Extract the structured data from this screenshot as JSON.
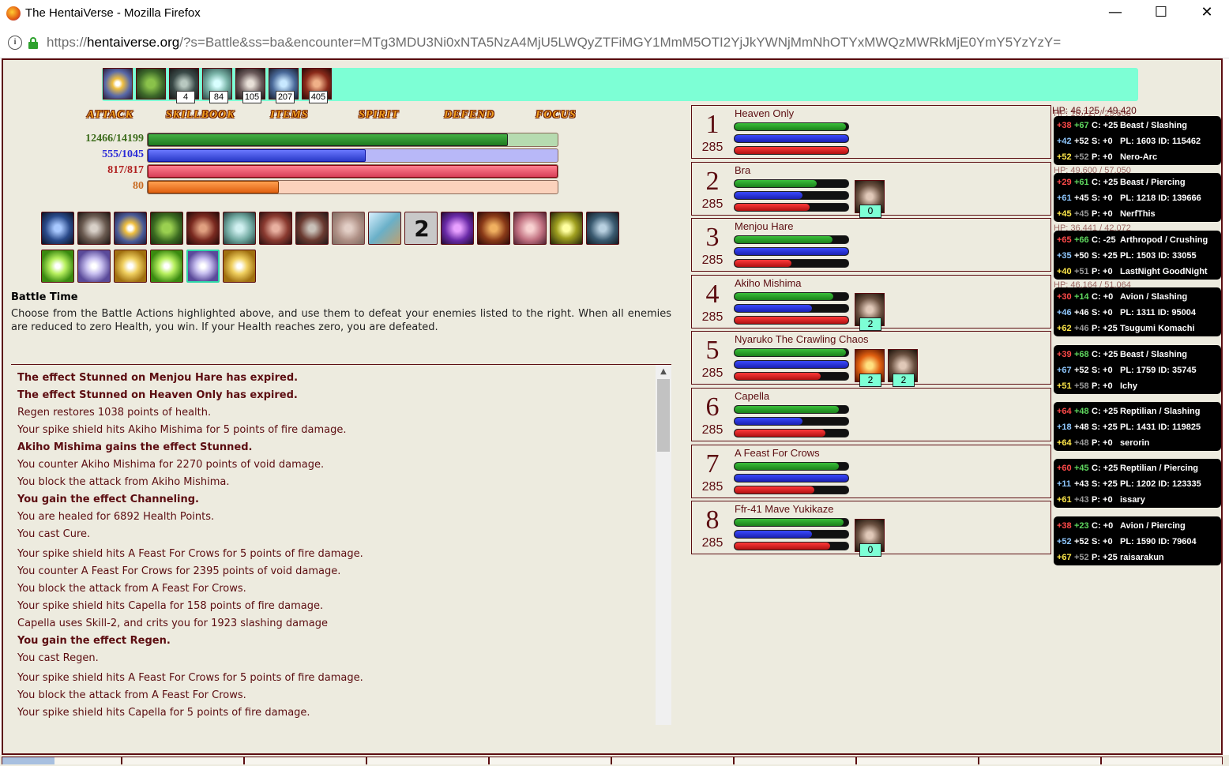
{
  "window": {
    "title": "The HentaiVerse - Mozilla Firefox",
    "minimize": "—",
    "maximize": "☐",
    "close": "✕"
  },
  "urlbar": {
    "prefix": "https://",
    "domain": "hentaiverse.org",
    "path": "/?s=Battle&ss=ba&encounter=MTg3MDU3Ni0xNTA5NzA4MjU5LWQyZTFiMGY1MmM5OTI2YjJkYWNjMmNhOTYxMWQzMWRkMjE0YmY5YzYzY="
  },
  "effects": {
    "counts": [
      "4",
      "84",
      "105",
      "207",
      "405"
    ]
  },
  "menu": {
    "attack": "ATTACK",
    "skillbook": "SKILLBOOK",
    "items": "ITEMS",
    "spirit": "SPIRIT",
    "defend": "DEFEND",
    "focus": "FOCUS"
  },
  "player": {
    "hp": {
      "text": "12466/14199",
      "fraction": 0.878
    },
    "mp": {
      "text": "555/1045",
      "fraction": 0.531
    },
    "sp": {
      "text": "817/817",
      "fraction": 1.0
    },
    "oc": {
      "text": "80",
      "fraction": 0.32
    }
  },
  "skills": {
    "count_label": "2"
  },
  "battle": {
    "title": "Battle Time",
    "description": "Choose from the Battle Actions highlighted above, and use them to defeat your enemies listed to the right. When all enemies are reduced to zero Health, you win. If your Health reaches zero, you are defeated."
  },
  "log": [
    {
      "text": "The effect Stunned on Menjou Hare has expired.",
      "bold": true
    },
    {
      "text": "The effect Stunned on Heaven Only has expired.",
      "bold": true
    },
    {
      "text": "Regen restores 1038 points of health.",
      "bold": false
    },
    {
      "text": "Your spike shield hits Akiho Mishima for 5 points of fire damage.",
      "bold": false
    },
    {
      "text": "Akiho Mishima gains the effect Stunned.",
      "bold": true
    },
    {
      "text": "You counter Akiho Mishima for 2270 points of void damage.",
      "bold": false
    },
    {
      "text": "You block the attack from Akiho Mishima.",
      "bold": false
    },
    {
      "text": "You gain the effect Channeling.",
      "bold": true
    },
    {
      "text": "You are healed for 6892 Health Points.",
      "bold": false
    },
    {
      "text": "You cast Cure.",
      "bold": false
    },
    {
      "text": "Your spike shield hits A Feast For Crows for 5 points of fire damage.",
      "bold": false
    },
    {
      "text": "You counter A Feast For Crows for 2395 points of void damage.",
      "bold": false
    },
    {
      "text": "You block the attack from A Feast For Crows.",
      "bold": false
    },
    {
      "text": "Your spike shield hits Capella for 158 points of fire damage.",
      "bold": false
    },
    {
      "text": "Capella uses Skill-2, and crits you for 1923 slashing damage",
      "bold": false
    },
    {
      "text": "You gain the effect Regen.",
      "bold": true
    },
    {
      "text": "You cast Regen.",
      "bold": false
    },
    {
      "text": "Your spike shield hits A Feast For Crows for 5 points of fire damage.",
      "bold": false
    },
    {
      "text": "You block the attack from A Feast For Crows.",
      "bold": false
    },
    {
      "text": "Your spike shield hits Capella for 5 points of fire damage.",
      "bold": false
    }
  ],
  "monsters": [
    {
      "num": "1",
      "level": "285",
      "name": "Heaven Only",
      "hp": 0.98,
      "mp": 1.0,
      "sp": 1.0,
      "effects": []
    },
    {
      "num": "2",
      "level": "285",
      "name": "Bra",
      "hp": 0.72,
      "mp": 0.6,
      "sp": 0.66,
      "effects": [
        "0"
      ]
    },
    {
      "num": "3",
      "level": "285",
      "name": "Menjou Hare",
      "hp": 0.86,
      "mp": 1.0,
      "sp": 0.5,
      "effects": []
    },
    {
      "num": "4",
      "level": "285",
      "name": "Akiho Mishima",
      "hp": 0.87,
      "mp": 0.68,
      "sp": 1.0,
      "effects": [
        "2"
      ]
    },
    {
      "num": "5",
      "level": "285",
      "name": "Nyaruko The Crawling Chaos",
      "hp": 0.98,
      "mp": 1.0,
      "sp": 0.76,
      "effects": [
        "2",
        "2"
      ]
    },
    {
      "num": "6",
      "level": "285",
      "name": "Capella",
      "hp": 0.92,
      "mp": 0.6,
      "sp": 0.8,
      "effects": []
    },
    {
      "num": "7",
      "level": "285",
      "name": "A Feast For Crows",
      "hp": 0.92,
      "mp": 1.0,
      "sp": 0.7,
      "effects": []
    },
    {
      "num": "8",
      "level": "285",
      "name": "Ffr-41 Mave Yukikaze",
      "hp": 0.96,
      "mp": 0.68,
      "sp": 0.84,
      "effects": [
        "0"
      ]
    }
  ],
  "tooltip_header": "HP: 46,125 / 49,420",
  "tooltips": [
    {
      "r1": [
        "+38",
        "+67",
        "C: +25",
        "Beast / Slashing"
      ],
      "r2": [
        "+42",
        "+52",
        "S: +0",
        "PL: 1603 ID: 115462"
      ],
      "r3": [
        "+52",
        "+52",
        "P: +0",
        "Nero-Arc"
      ],
      "hpnote": "HP: 16,717 / 23,600"
    },
    {
      "r1": [
        "+29",
        "+61",
        "C: +25",
        "Beast / Piercing"
      ],
      "r2": [
        "+61",
        "+45",
        "S: +0",
        "PL: 1218 ID: 139666"
      ],
      "r3": [
        "+45",
        "+45",
        "P: +0",
        "NerfThis"
      ],
      "hpnote": "HP: 49,600 / 57,050"
    },
    {
      "r1": [
        "+65",
        "+66",
        "C: -25",
        "Arthropod / Crushing"
      ],
      "r2": [
        "+35",
        "+50",
        "S: +25",
        "PL: 1503 ID: 33055"
      ],
      "r3": [
        "+40",
        "+51",
        "P: +0",
        "LastNight GoodNight"
      ],
      "hpnote": "HP: 36,441 / 42,072"
    },
    {
      "r1": [
        "+30",
        "+14",
        "C: +0",
        "Avion / Slashing"
      ],
      "r2": [
        "+46",
        "+46",
        "S: +0",
        "PL: 1311 ID: 95004"
      ],
      "r3": [
        "+62",
        "+46",
        "P: +25",
        "Tsugumi Komachi"
      ],
      "hpnote": "HP: 46,164 / 51,064"
    },
    {
      "r1": [
        "+39",
        "+68",
        "C: +25",
        "Beast / Slashing"
      ],
      "r2": [
        "+67",
        "+52",
        "S: +0",
        "PL: 1759 ID: 35745"
      ],
      "r3": [
        "+51",
        "+58",
        "P: +0",
        "Ichy"
      ],
      "hpnote": ""
    },
    {
      "r1": [
        "+64",
        "+48",
        "C: +25",
        "Reptilian / Slashing"
      ],
      "r2": [
        "+18",
        "+48",
        "S: +25",
        "PL: 1431 ID: 119825"
      ],
      "r3": [
        "+64",
        "+48",
        "P: +0",
        "serorin"
      ],
      "hpnote": ""
    },
    {
      "r1": [
        "+60",
        "+45",
        "C: +25",
        "Reptilian / Piercing"
      ],
      "r2": [
        "+11",
        "+43",
        "S: +25",
        "PL: 1202 ID: 123335"
      ],
      "r3": [
        "+61",
        "+43",
        "P: +0",
        "issary"
      ],
      "hpnote": ""
    },
    {
      "r1": [
        "+38",
        "+23",
        "C: +0",
        "Avion / Piercing"
      ],
      "r2": [
        "+52",
        "+52",
        "S: +0",
        "PL: 1590 ID: 79604"
      ],
      "r3": [
        "+67",
        "+52",
        "P: +25",
        "raisarakun"
      ],
      "hpnote": ""
    }
  ]
}
